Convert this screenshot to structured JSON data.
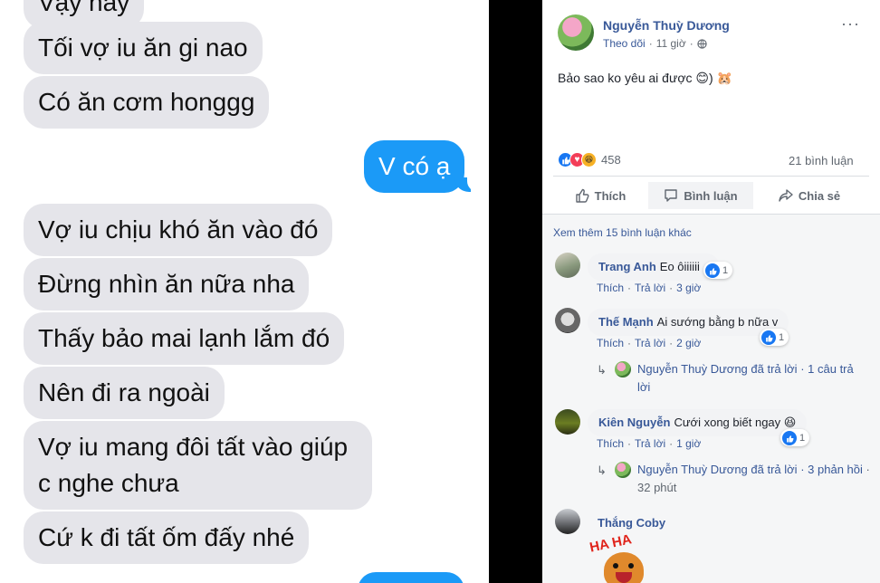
{
  "chat": {
    "messages": [
      {
        "text": "Vậy nay",
        "from": "them"
      },
      {
        "text": "Tối vợ iu ăn gi nao",
        "from": "them"
      },
      {
        "text": "Có ăn cơm honggg",
        "from": "them"
      },
      {
        "text": "V có ạ",
        "from": "me"
      },
      {
        "text": "Vợ iu chịu khó ăn vào đó",
        "from": "them"
      },
      {
        "text": "Đừng nhìn ăn nữa nha",
        "from": "them"
      },
      {
        "text": "Thấy bảo mai lạnh lắm đó",
        "from": "them"
      },
      {
        "text": "Nên đi ra ngoài",
        "from": "them"
      },
      {
        "text": "Vợ iu mang đôi tất vào giúp c nghe chưa",
        "from": "them"
      },
      {
        "text": "Cứ k đi tất ốm đấy nhé",
        "from": "them"
      }
    ],
    "colors": {
      "them_bubble": "#e5e5ea",
      "me_bubble": "#1b9af7"
    }
  },
  "post": {
    "author": "Nguyễn Thuỳ Dương",
    "follow": "Theo dõi",
    "time": "11 giờ",
    "body": "Bảo sao ko yêu ai được 😊) 🐹",
    "reaction_count": "458",
    "comment_count": "21 bình luận",
    "actions": {
      "like": "Thích",
      "comment": "Bình luận",
      "share": "Chia sẻ"
    },
    "more_comments": "Xem thêm 15 bình luận khác",
    "comments": [
      {
        "name": "Trang Anh",
        "text": "Eo ôiiiiii",
        "likes": "1",
        "like": "Thích",
        "reply": "Trả lời",
        "time": "3 giờ"
      },
      {
        "name": "Thế Mạnh",
        "text": "Ai sướng bằng b nữa v",
        "likes": "1",
        "like": "Thích",
        "reply": "Trả lời",
        "time": "2 giờ",
        "reply_summary": {
          "author": "Nguyễn Thuỳ Dương",
          "action": "đã trả lời",
          "count": "1 câu trả lời"
        }
      },
      {
        "name": "Kiên Nguyễn",
        "text": "Cưới xong biết ngay 😆",
        "likes": "1",
        "like": "Thích",
        "reply": "Trả lời",
        "time": "1 giờ",
        "reply_summary": {
          "author": "Nguyễn Thuỳ Dương",
          "action": "đã trả lời",
          "count": "3 phản hồi",
          "time": "32 phút"
        }
      },
      {
        "name": "Thắng Coby",
        "sticker_text": "HA HA"
      }
    ],
    "colors": {
      "link": "#385898",
      "like_blue": "#1877f2",
      "love_red": "#f33e58",
      "haha_yellow": "#f7b125"
    }
  }
}
